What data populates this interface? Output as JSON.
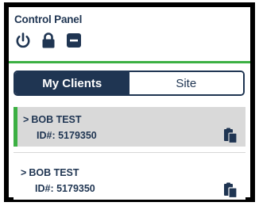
{
  "panel": {
    "title": "Control Panel",
    "icons": [
      "power-icon",
      "lock-icon",
      "minus-square-icon"
    ]
  },
  "tabs": [
    {
      "label": "My Clients",
      "active": true
    },
    {
      "label": "Site",
      "active": false
    }
  ],
  "clients": [
    {
      "name": "BOB TEST",
      "id_label": "ID#: 5179350",
      "selected": true,
      "icon": "clipboard-icon"
    },
    {
      "name": "BOB TEST",
      "id_label": "ID#: 5179350",
      "selected": false,
      "icon": "clipboard-icon"
    }
  ],
  "colors": {
    "navy": "#1f3552",
    "accent_green": "#3cb043",
    "selected_bg": "#d9d9d9",
    "frame": "#000000"
  }
}
